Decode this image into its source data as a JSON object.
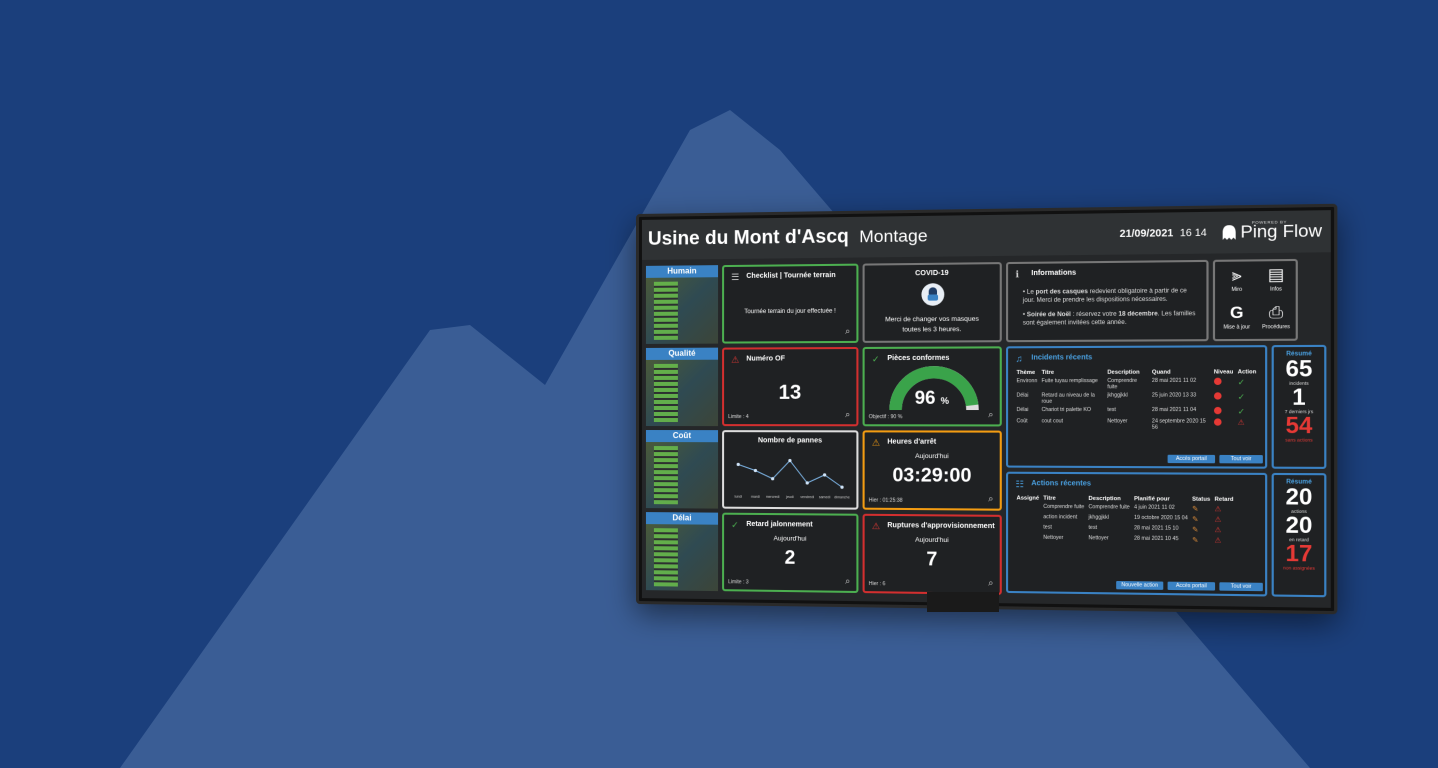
{
  "header": {
    "factory": "Usine du Mont d'Ascq",
    "area": "Montage",
    "date": "21/09/2021",
    "time": "16 14",
    "brand_top": "POWERED BY",
    "brand_name": "Ping Flow"
  },
  "categories": [
    {
      "label": "Humain"
    },
    {
      "label": "Qualité"
    },
    {
      "label": "Coût"
    },
    {
      "label": "Délai"
    }
  ],
  "tiles": {
    "checklist": {
      "title": "Checklist | Tournée terrain",
      "text": "Tournée terrain du jour effectuée !"
    },
    "covid": {
      "title": "COVID-19",
      "line1": "Merci de changer vos masques",
      "line2": "toutes les 3 heures."
    },
    "numero_of": {
      "title": "Numéro OF",
      "value": "13",
      "footer": "Limite : 4"
    },
    "pieces": {
      "title": "Pièces conformes",
      "value": "96",
      "unit": "%",
      "footer": "Objectif : 90 %",
      "gauge_fraction": 0.96
    },
    "pannes": {
      "title": "Nombre de pannes",
      "days": [
        "lundi",
        "mardi",
        "mercredi",
        "jeudi",
        "vendredi",
        "samedi",
        "dimanche"
      ]
    },
    "heures": {
      "title": "Heures d'arrêt",
      "sub": "Aujourd'hui",
      "value": "03:29:00",
      "footer": "Hier : 01:25:38"
    },
    "retard": {
      "title": "Retard jalonnement",
      "sub": "Aujourd'hui",
      "value": "2",
      "footer": "Limite : 3"
    },
    "ruptures": {
      "title": "Ruptures d'approvisionnement",
      "sub": "Aujourd'hui",
      "value": "7",
      "footer": "Hier : 6"
    }
  },
  "informations": {
    "title": "Informations",
    "b1_pre": "Le ",
    "b1_bold": "port des casques",
    "b1_post": " redevient obligatoire à partir de ce jour. Merci de prendre les dispositions nécessaires.",
    "b2_bold": "Soirée de Noël",
    "b2_mid": " : réservez votre ",
    "b2_bold2": "18 décembre",
    "b2_post": ". Les familles sont également invitées cette année."
  },
  "shortcuts": [
    {
      "icon": "miro-icon",
      "label": "Miro"
    },
    {
      "icon": "news-icon",
      "label": "Infos"
    },
    {
      "icon": "google-icon",
      "label": "Mise à jour"
    },
    {
      "icon": "pdf-icon",
      "label": "Procédures"
    }
  ],
  "incidents": {
    "title": "Incidents récents",
    "headers": [
      "Thème",
      "Titre",
      "Description",
      "Quand",
      "Niveau",
      "Action"
    ],
    "rows": [
      {
        "theme": "Environn",
        "titre": "Fuite tuyau remplissage",
        "desc": "Comprendre fuite",
        "quand": "28 mai 2021 11 02"
      },
      {
        "theme": "Délai",
        "titre": "Retard au niveau de la roue",
        "desc": "jkhggjkkl",
        "quand": "25 juin 2020 13 33"
      },
      {
        "theme": "Délai",
        "titre": "Chariot tri palette KO",
        "desc": "test",
        "quand": "28 mai 2021 11 04"
      },
      {
        "theme": "Coût",
        "titre": "cout cout",
        "desc": "Nettoyer",
        "quand": "24 septembre 2020 15 56"
      }
    ],
    "btn_portal": "Accès portail",
    "btn_all": "Tout voir"
  },
  "actions": {
    "title": "Actions récentes",
    "headers": [
      "Assigné",
      "Titre",
      "Description",
      "Planifié pour",
      "Status",
      "Retard"
    ],
    "rows": [
      {
        "titre": "Comprendre fuite",
        "desc": "Comprendre fuite",
        "plan": "4 juin 2021 11 02"
      },
      {
        "titre": "action incident",
        "desc": "jkhggjkkl",
        "plan": "19 octobre 2020 15 04"
      },
      {
        "titre": "test",
        "desc": "test",
        "plan": "28 mai 2021 15 10"
      },
      {
        "titre": "Nettoyer",
        "desc": "Nettoyer",
        "plan": "28 mai 2021 10 45"
      }
    ],
    "btn_new": "Nouvelle action",
    "btn_portal": "Accès portail",
    "btn_all": "Tout voir"
  },
  "summary_incidents": {
    "title": "Résumé",
    "n1": "65",
    "c1": "incidents",
    "n2": "1",
    "c2": "7 derniers jrs",
    "n3": "54",
    "c3": "sans actions"
  },
  "summary_actions": {
    "title": "Résumé",
    "n1": "20",
    "c1": "actions",
    "n2": "20",
    "c2": "en retard",
    "n3": "17",
    "c3": "non assignées"
  },
  "colors": {
    "background": "#1b3f7c",
    "mountain": "#3a5d95",
    "accent": "#3a82c4",
    "ok": "#4caf50",
    "alert": "#e53935",
    "warn": "#f39c12"
  }
}
